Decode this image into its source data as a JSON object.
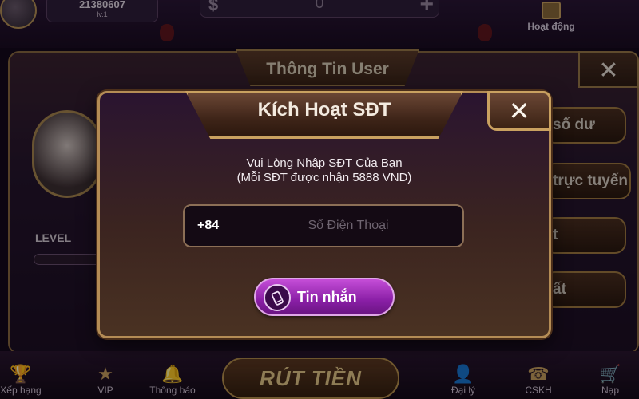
{
  "topbar": {
    "balance": "21380607",
    "level": "lv.1",
    "coin_symbol": "$",
    "coin_value": "0",
    "plus_symbol": "+",
    "event_label": "Hoạt động"
  },
  "user_panel": {
    "title": "Thông Tin User",
    "close_symbol": "✕",
    "level_label": "LEVEL",
    "side_buttons": [
      "số dư",
      "trực tuyến",
      "t",
      "ất"
    ]
  },
  "bottom_nav": {
    "items": [
      "Xếp hạng",
      "VIP",
      "Thông báo",
      "Đại lý",
      "CSKH",
      "Nạp"
    ],
    "withdraw_label": "RÚT TIỀN"
  },
  "dialog": {
    "title": "Kích Hoạt SĐT",
    "close_symbol": "✕",
    "instruction_line1": "Vui Lòng Nhập SĐT Của Bạn",
    "instruction_line2": "(Mỗi SĐT được nhận 5888 VND)",
    "country_code": "+84",
    "phone_placeholder": "Số Điện Thoại",
    "phone_value": "",
    "sms_button_label": "Tin nhắn"
  },
  "icons": {
    "sms": "phone-message-icon",
    "close": "close-icon",
    "gift": "gift-icon"
  },
  "colors": {
    "accent_gold": "#c9a160",
    "button_purple": "#8a1fa6",
    "panel_dark": "#2a1430"
  }
}
